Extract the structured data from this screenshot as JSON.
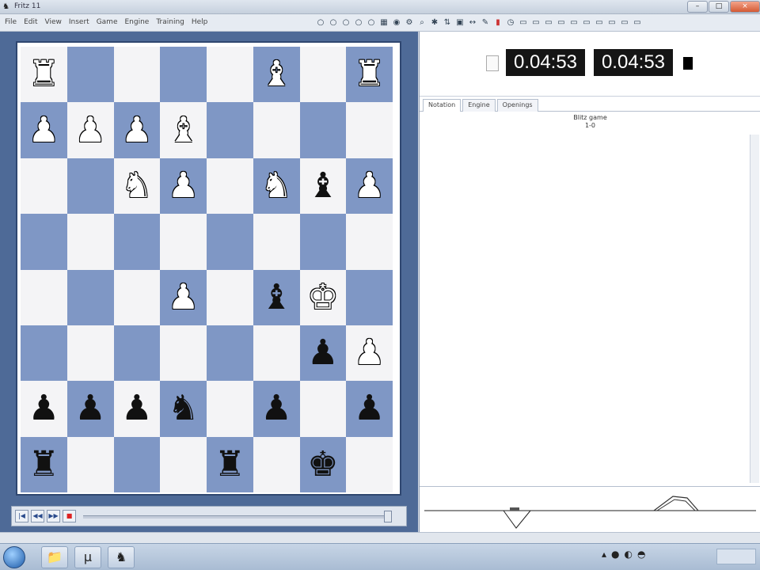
{
  "window": {
    "title": "Fritz 11",
    "controls": {
      "minimize": "–",
      "maximize": "□",
      "close": "×"
    }
  },
  "menubar": {
    "items": [
      "File",
      "Edit",
      "View",
      "Insert",
      "Game",
      "Engine",
      "Training",
      "Help"
    ],
    "toolbar_icons": [
      "circle-icon",
      "circle-icon",
      "circle-icon",
      "circle-icon",
      "circle-icon",
      "grid-icon",
      "bulb-icon",
      "engine-icon",
      "search-icon",
      "settings-icon",
      "flip-icon",
      "board-icon",
      "move-icon",
      "edit-icon",
      "red-icon",
      "clock-icon",
      "window-icon",
      "window-icon",
      "window-icon",
      "window-icon",
      "window-icon",
      "window-icon",
      "window-icon",
      "window-icon",
      "window-icon",
      "window-icon"
    ]
  },
  "board": {
    "colors": {
      "light": "#f4f4f6",
      "dark": "#7f97c5",
      "frame": "#2f4770"
    },
    "ranks": [
      [
        "wR",
        "",
        "",
        "",
        "",
        "wB",
        "",
        "wR"
      ],
      [
        "wP",
        "wP",
        "wP",
        "wB",
        "",
        "",
        "",
        ""
      ],
      [
        "",
        "",
        "wN",
        "wP",
        "",
        "wN",
        "bB",
        "wP"
      ],
      [
        "",
        "",
        "",
        "",
        "",
        "",
        "",
        ""
      ],
      [
        "",
        "",
        "",
        "wP",
        "",
        "bB",
        "wK",
        ""
      ],
      [
        "",
        "",
        "",
        "",
        "",
        "",
        "bP",
        "wP"
      ],
      [
        "bP",
        "bP",
        "bP",
        "bN",
        "",
        "bP",
        "",
        "bP"
      ],
      [
        "bR",
        "",
        "",
        "",
        "bR",
        "",
        "bK",
        ""
      ]
    ],
    "glyphs": {
      "K": "♚",
      "Q": "♛",
      "R": "♜",
      "B": "♝",
      "N": "♞",
      "P": "♟"
    }
  },
  "navigation": {
    "buttons": [
      "|◀",
      "◀◀",
      "▶▶",
      "■"
    ]
  },
  "clocks": {
    "white": "0.04:53",
    "black": "0.04:53"
  },
  "notation_panel": {
    "tabs": [
      "Notation",
      "Engine",
      "Openings"
    ],
    "header_line1": "Blitz game",
    "header_line2": "1-0"
  },
  "taskbar": {
    "apps": [
      "folder-icon",
      "torrent-icon",
      "fritz-icon"
    ]
  }
}
